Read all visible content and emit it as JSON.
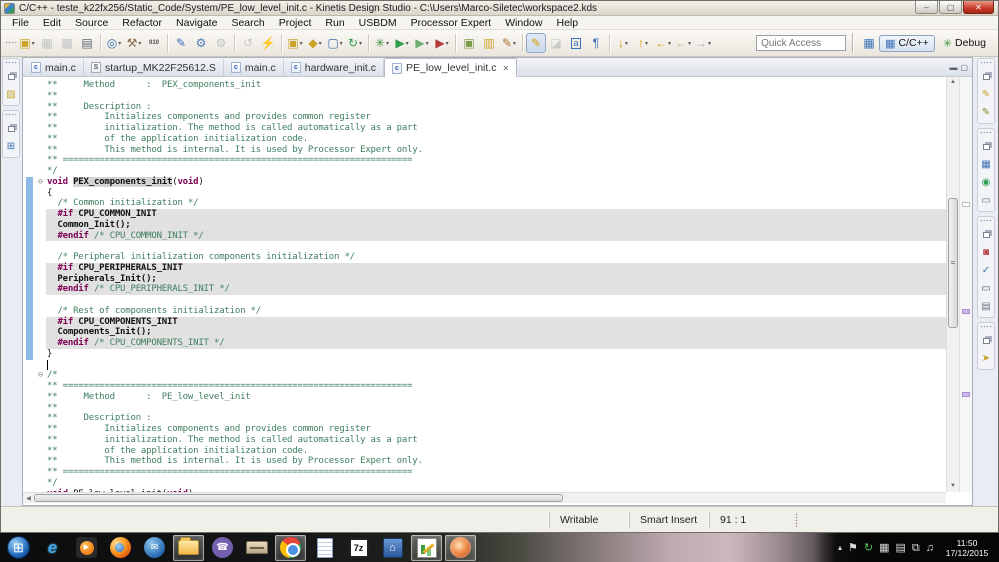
{
  "window": {
    "title": "C/C++ - teste_k22fx256/Static_Code/System/PE_low_level_init.c - Kinetis Design Studio - C:\\Users\\Marco-Siletec\\workspace2.kds",
    "minimize": "–",
    "maximize": "▢",
    "close": "✕"
  },
  "menu": {
    "items": [
      "File",
      "Edit",
      "Source",
      "Refactor",
      "Navigate",
      "Search",
      "Project",
      "Run",
      "USBDM",
      "Processor Expert",
      "Window",
      "Help"
    ]
  },
  "toolbar": {
    "quick_access_placeholder": "Quick Access",
    "open_perspective_glyph": "▦",
    "perspectives": [
      {
        "label": "C/C++",
        "icon": "▦",
        "icon_color": "#3b6fb6",
        "pressed": true
      },
      {
        "label": "Debug",
        "icon": "✳",
        "icon_color": "#3f8f3f",
        "pressed": false
      }
    ],
    "items": [
      {
        "n": "new-button",
        "g": "▣",
        "c": "#c9a227",
        "caret": true
      },
      {
        "n": "save-button",
        "g": "▦",
        "c": "#8a909a",
        "dis": true
      },
      {
        "n": "save-all-button",
        "g": "▩",
        "c": "#8a909a",
        "dis": true
      },
      {
        "n": "print-button",
        "g": "▤",
        "c": "#5a6570"
      },
      {
        "sep": true
      },
      {
        "n": "debug-config-button",
        "g": "◎",
        "c": "#3b6fb6",
        "caret": true
      },
      {
        "n": "build-button",
        "g": "⚒",
        "c": "#8a6d4a",
        "caret": true
      },
      {
        "n": "binary-tools-button",
        "g": "010",
        "c": "#444444",
        "small": true
      },
      {
        "sep": true
      },
      {
        "n": "mark-pen-button",
        "g": "✎",
        "c": "#3b6fb6"
      },
      {
        "n": "build-settings-button",
        "g": "⚙",
        "c": "#4a7ab5"
      },
      {
        "n": "gear-sync-button",
        "g": "⚙",
        "c": "#8a909a",
        "dis": true
      },
      {
        "sep": true
      },
      {
        "n": "revert-button",
        "g": "↺",
        "c": "#8a909a",
        "dis": true
      },
      {
        "n": "flash-program-button",
        "g": "⚡",
        "c": "#e8a000"
      },
      {
        "sep": true
      },
      {
        "n": "new-project-button",
        "g": "▣",
        "c": "#c9a227",
        "caret": true
      },
      {
        "n": "new-class-button",
        "g": "◆",
        "c": "#c9a227",
        "caret": true
      },
      {
        "n": "new-file-button",
        "g": "▢",
        "c": "#3b6fb6",
        "caret": true
      },
      {
        "n": "restart-button",
        "g": "↻",
        "c": "#2e9e4f",
        "caret": true
      },
      {
        "sep": true
      },
      {
        "n": "debug-button",
        "g": "✳",
        "c": "#3f8f3f",
        "caret": true
      },
      {
        "n": "run-button",
        "g": "▶",
        "c": "#2e9e4f",
        "caret": true
      },
      {
        "n": "run-last-button",
        "g": "▶",
        "c": "#6fae6f",
        "caret": true
      },
      {
        "n": "coverage-button",
        "g": "▶",
        "c": "#b23b3b",
        "caret": true
      },
      {
        "sep": true
      },
      {
        "n": "new-wizard-button",
        "g": "▣",
        "c": "#7c9c4a"
      },
      {
        "n": "open-element-button",
        "g": "▥",
        "c": "#c9a227"
      },
      {
        "n": "format-brush-button",
        "g": "✎",
        "c": "#b06f2f",
        "caret": true
      },
      {
        "sep": true
      },
      {
        "n": "highlight-button",
        "g": "✎",
        "c": "#d4a106",
        "pressed": true
      },
      {
        "n": "dim-marker-button",
        "g": "◪",
        "c": "#9aa0a8",
        "dis": true
      },
      {
        "n": "show-annotations-button",
        "g": "a",
        "c": "#3b6fb6",
        "boxed": true
      },
      {
        "n": "show-whitespace-button",
        "g": "¶",
        "c": "#3b6fb6"
      },
      {
        "sep": true
      },
      {
        "n": "last-edit-location-button",
        "g": "↓",
        "c": "#d49d0a",
        "caret": true
      },
      {
        "n": "goto-up-button",
        "g": "↑",
        "c": "#d49d0a",
        "caret": true
      },
      {
        "n": "back-history-button",
        "g": "←",
        "c": "#d49d0a",
        "caret": true
      },
      {
        "n": "back-button",
        "g": "←",
        "c": "#c9a96a",
        "caret": true
      },
      {
        "n": "forward-button",
        "g": "→",
        "c": "#b0b0b0",
        "caret": true
      }
    ]
  },
  "left_strip": {
    "groups": [
      {
        "icons": [
          {
            "n": "project-explorer-button",
            "g": "▨",
            "c": "#c9a227"
          }
        ]
      },
      {
        "icons": [
          {
            "n": "outline-tree-button",
            "g": "⊞",
            "c": "#3b6fb6"
          }
        ]
      }
    ]
  },
  "right_strip": {
    "groups": [
      {
        "icons": [
          {
            "n": "snippets-view-button",
            "g": "✎",
            "c": "#c9a227"
          },
          {
            "n": "templates-view-button",
            "g": "✎",
            "c": "#8a8a2a"
          }
        ]
      },
      {
        "icons": [
          {
            "n": "outline-view-button",
            "g": "▦",
            "c": "#3b6fb6"
          },
          {
            "n": "debug-target-view-button",
            "g": "◉",
            "c": "#2e9e4f"
          },
          {
            "n": "console-view-button",
            "g": "▭",
            "c": "#6a7686"
          }
        ]
      },
      {
        "icons": [
          {
            "n": "problems-view-button",
            "g": "◙",
            "c": "#b23b3b"
          },
          {
            "n": "tasks-view-button",
            "g": "✓",
            "c": "#3b6fb6"
          },
          {
            "n": "memory-view-button",
            "g": "▭",
            "c": "#4a5a6a"
          },
          {
            "n": "properties-view-button",
            "g": "▤",
            "c": "#6a7686"
          }
        ]
      },
      {
        "icons": [
          {
            "n": "search-view-button",
            "g": "➤",
            "c": "#c9a227"
          }
        ]
      }
    ]
  },
  "tabs": [
    {
      "label": "main.c",
      "icon": "c",
      "asm": false,
      "active": false
    },
    {
      "label": "startup_MK22F25612.S",
      "icon": "S",
      "asm": true,
      "active": false
    },
    {
      "label": "main.c",
      "icon": "c",
      "asm": false,
      "active": false
    },
    {
      "label": "hardware_init.c",
      "icon": "c",
      "asm": false,
      "active": false
    },
    {
      "label": "PE_low_level_init.c",
      "icon": "c",
      "asm": false,
      "active": true,
      "close": "✕"
    }
  ],
  "editor": {
    "fold_glyph": "⊖",
    "lines": [
      {
        "s": [
          [
            "cm",
            "**     Method      :  PEX_components_init"
          ]
        ]
      },
      {
        "s": [
          [
            "cm",
            "**"
          ]
        ]
      },
      {
        "s": [
          [
            "cm",
            "**     Description :"
          ]
        ]
      },
      {
        "s": [
          [
            "cm",
            "**         Initializes components and provides common register"
          ]
        ]
      },
      {
        "s": [
          [
            "cm",
            "**         initialization. The method is called automatically as a part"
          ]
        ]
      },
      {
        "s": [
          [
            "cm",
            "**         of the application initialization code."
          ]
        ]
      },
      {
        "s": [
          [
            "cm",
            "**         This method is internal. It is used by Processor Expert only."
          ]
        ]
      },
      {
        "s": [
          [
            "cm",
            "** ==================================================================="
          ]
        ]
      },
      {
        "s": [
          [
            "cm",
            "*/"
          ]
        ]
      },
      {
        "fold": true,
        "range": true,
        "s": [
          [
            "kw",
            "void"
          ],
          [
            "pl",
            " "
          ],
          [
            "oc",
            "PEX_components_init"
          ],
          [
            "pl",
            "("
          ],
          [
            "kw",
            "void"
          ],
          [
            "pl",
            ")"
          ]
        ]
      },
      {
        "range": true,
        "s": [
          [
            "pl",
            "{"
          ]
        ]
      },
      {
        "range": true,
        "s": [
          [
            "pl",
            "  "
          ],
          [
            "cm",
            "/* Common initialization */"
          ]
        ]
      },
      {
        "range": true,
        "bg": true,
        "s": [
          [
            "pl",
            "  "
          ],
          [
            "pp",
            "#if"
          ],
          [
            "bd",
            " CPU_COMMON_INIT"
          ]
        ]
      },
      {
        "range": true,
        "bg": true,
        "s": [
          [
            "bd",
            "  Common_Init();"
          ]
        ]
      },
      {
        "range": true,
        "bg": true,
        "s": [
          [
            "pl",
            "  "
          ],
          [
            "pp",
            "#endif"
          ],
          [
            "pl",
            " "
          ],
          [
            "cm",
            "/* CPU_COMMON_INIT */"
          ]
        ]
      },
      {
        "range": true,
        "s": []
      },
      {
        "range": true,
        "s": [
          [
            "pl",
            "  "
          ],
          [
            "cm",
            "/* Peripheral initialization components initialization */"
          ]
        ]
      },
      {
        "range": true,
        "bg": true,
        "s": [
          [
            "pl",
            "  "
          ],
          [
            "pp",
            "#if"
          ],
          [
            "bd",
            " CPU_PERIPHERALS_INIT"
          ]
        ]
      },
      {
        "range": true,
        "bg": true,
        "s": [
          [
            "bd",
            "  Peripherals_Init();"
          ]
        ]
      },
      {
        "range": true,
        "bg": true,
        "s": [
          [
            "pl",
            "  "
          ],
          [
            "pp",
            "#endif"
          ],
          [
            "pl",
            " "
          ],
          [
            "cm",
            "/* CPU_PERIPHERALS_INIT */"
          ]
        ]
      },
      {
        "range": true,
        "s": []
      },
      {
        "range": true,
        "s": [
          [
            "pl",
            "  "
          ],
          [
            "cm",
            "/* Rest of components initialization */"
          ]
        ]
      },
      {
        "range": true,
        "bg": true,
        "s": [
          [
            "pl",
            "  "
          ],
          [
            "pp",
            "#if"
          ],
          [
            "bd",
            " CPU_COMPONENTS_INIT"
          ]
        ]
      },
      {
        "range": true,
        "bg": true,
        "s": [
          [
            "bd",
            "  Components_Init();"
          ]
        ]
      },
      {
        "range": true,
        "bg": true,
        "s": [
          [
            "pl",
            "  "
          ],
          [
            "pp",
            "#endif"
          ],
          [
            "pl",
            " "
          ],
          [
            "cm",
            "/* CPU_COMPONENTS_INIT */"
          ]
        ]
      },
      {
        "range": true,
        "s": [
          [
            "pl",
            "}"
          ]
        ]
      },
      {
        "cursor": true,
        "s": []
      },
      {
        "fold": true,
        "s": [
          [
            "cm",
            "/*"
          ]
        ]
      },
      {
        "s": [
          [
            "cm",
            "** ==================================================================="
          ]
        ]
      },
      {
        "s": [
          [
            "cm",
            "**     Method      :  PE_low_level_init"
          ]
        ]
      },
      {
        "s": [
          [
            "cm",
            "**"
          ]
        ]
      },
      {
        "s": [
          [
            "cm",
            "**     Description :"
          ]
        ]
      },
      {
        "s": [
          [
            "cm",
            "**         Initializes components and provides common register"
          ]
        ]
      },
      {
        "s": [
          [
            "cm",
            "**         initialization. The method is called automatically as a part"
          ]
        ]
      },
      {
        "s": [
          [
            "cm",
            "**         of the application initialization code."
          ]
        ]
      },
      {
        "s": [
          [
            "cm",
            "**         This method is internal. It is used by Processor Expert only."
          ]
        ]
      },
      {
        "s": [
          [
            "cm",
            "** ==================================================================="
          ]
        ]
      },
      {
        "s": [
          [
            "cm",
            "*/"
          ]
        ]
      },
      {
        "s": [
          [
            "kw",
            "void"
          ],
          [
            "pl",
            " PE_low_level_init("
          ],
          [
            "kw",
            "void"
          ],
          [
            "pl",
            ")"
          ]
        ]
      }
    ]
  },
  "status": {
    "writable": "Writable",
    "smart_insert": "Smart Insert",
    "cursor_position": "91 : 1"
  },
  "taskbar": {
    "items": [
      {
        "n": "start-button",
        "kind": "start",
        "g": "⊞"
      },
      {
        "n": "internet-explorer-icon",
        "kind": "ie",
        "g": "e"
      },
      {
        "n": "media-player-icon",
        "kind": "wmp",
        "g": "▶"
      },
      {
        "n": "firefox-icon",
        "kind": "firefox"
      },
      {
        "n": "thunderbird-icon",
        "kind": "thunderbird",
        "g": "✉"
      },
      {
        "n": "windows-explorer-icon",
        "kind": "explorer",
        "active": true
      },
      {
        "n": "viber-icon",
        "kind": "viber",
        "g": "☎"
      },
      {
        "n": "scanner-icon",
        "kind": "scanner"
      },
      {
        "n": "chrome-icon",
        "kind": "chrome",
        "active": true
      },
      {
        "n": "notepad-icon",
        "kind": "notepad"
      },
      {
        "n": "sevenzip-icon",
        "kind": "sevenzip",
        "g": "7z"
      },
      {
        "n": "kds-building-icon",
        "kind": "building",
        "g": "⌂"
      },
      {
        "n": "chart-app-icon",
        "kind": "chart",
        "active": true
      },
      {
        "n": "image-viewer-icon",
        "kind": "globe",
        "active": true
      }
    ],
    "tray": [
      {
        "n": "show-hidden-icons",
        "g": "▴",
        "small": true
      },
      {
        "n": "action-center-flag-icon",
        "g": "⚑"
      },
      {
        "n": "antivirus-icon",
        "g": "↻",
        "c": "#58c058"
      },
      {
        "n": "windows-grid-icon",
        "g": "▦"
      },
      {
        "n": "clipboard-tray-icon",
        "g": "▤"
      },
      {
        "n": "network-icon",
        "g": "⧉"
      },
      {
        "n": "volume-icon",
        "g": "♫"
      }
    ],
    "clock": {
      "time": "11:50",
      "date": "17/12/2015"
    }
  }
}
